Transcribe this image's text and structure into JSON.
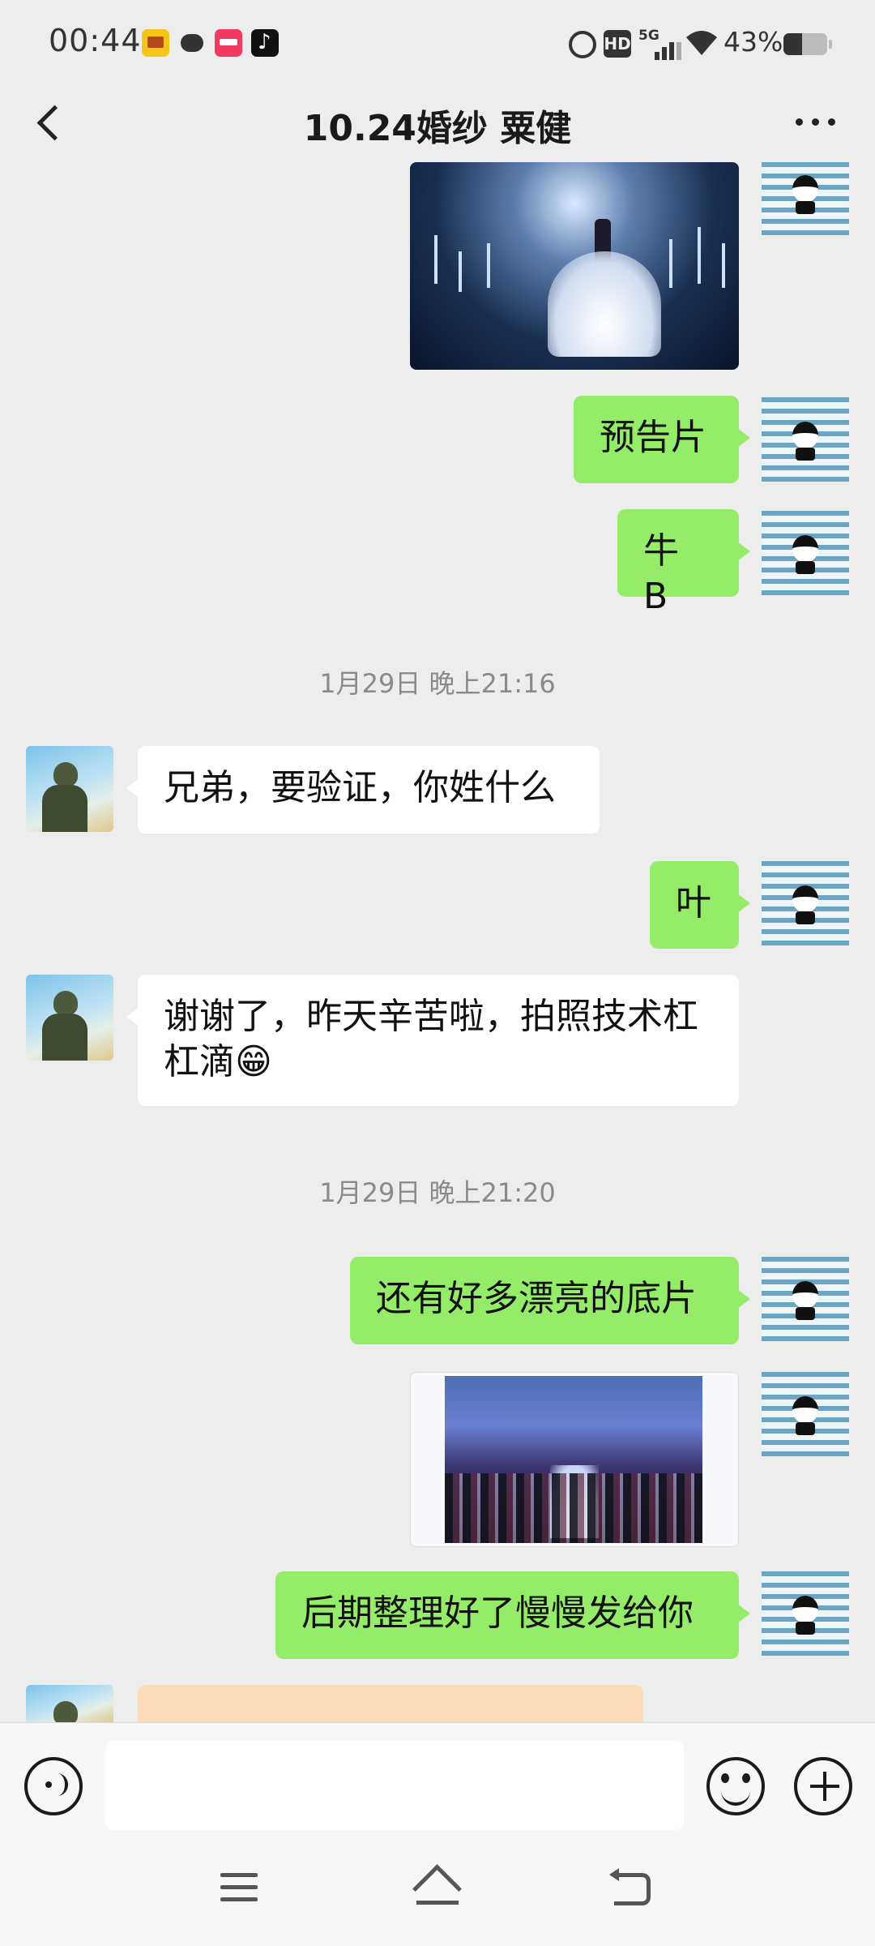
{
  "status_bar": {
    "time": "00:44",
    "notification_icons": [
      "yellow-app-icon",
      "message-bubble-icon",
      "red-app-icon",
      "tiktok-icon"
    ],
    "system_icons": [
      "alarm-icon",
      "hd-icon",
      "5g-signal-icon",
      "wifi-icon"
    ],
    "signal_label": "5G",
    "hd_label": "HD",
    "battery_pct": "43%",
    "battery_level": 0.43
  },
  "header": {
    "title": "10.24婚纱 粟健"
  },
  "messages": [
    {
      "type": "image",
      "sender": "me",
      "alt": "wedding stage photo"
    },
    {
      "type": "text",
      "sender": "me",
      "text": "预告片"
    },
    {
      "type": "text",
      "sender": "me",
      "text": "牛 B"
    },
    {
      "type": "timestamp",
      "text": "1月29日 晚上21:16"
    },
    {
      "type": "text",
      "sender": "other",
      "text": "兄弟，要验证，你姓什么"
    },
    {
      "type": "text",
      "sender": "me",
      "text": "叶"
    },
    {
      "type": "text",
      "sender": "other",
      "text": "谢谢了，昨天辛苦啦，拍照技术杠杠滴😁"
    },
    {
      "type": "timestamp",
      "text": "1月29日 晚上21:20"
    },
    {
      "type": "text",
      "sender": "me",
      "text": "还有好多漂亮的底片"
    },
    {
      "type": "image",
      "sender": "me",
      "alt": "wedding hall photo"
    },
    {
      "type": "text",
      "sender": "me",
      "text": "后期整理好了慢慢发给你"
    },
    {
      "type": "transfer",
      "sender": "other",
      "text": ""
    }
  ],
  "input": {
    "value": "",
    "placeholder": ""
  },
  "colors": {
    "background": "#ededed",
    "my_bubble": "#95ec69",
    "other_bubble": "#ffffff",
    "transfer_card": "#fcdcb7",
    "timestamp_text": "#8a8a8a"
  }
}
